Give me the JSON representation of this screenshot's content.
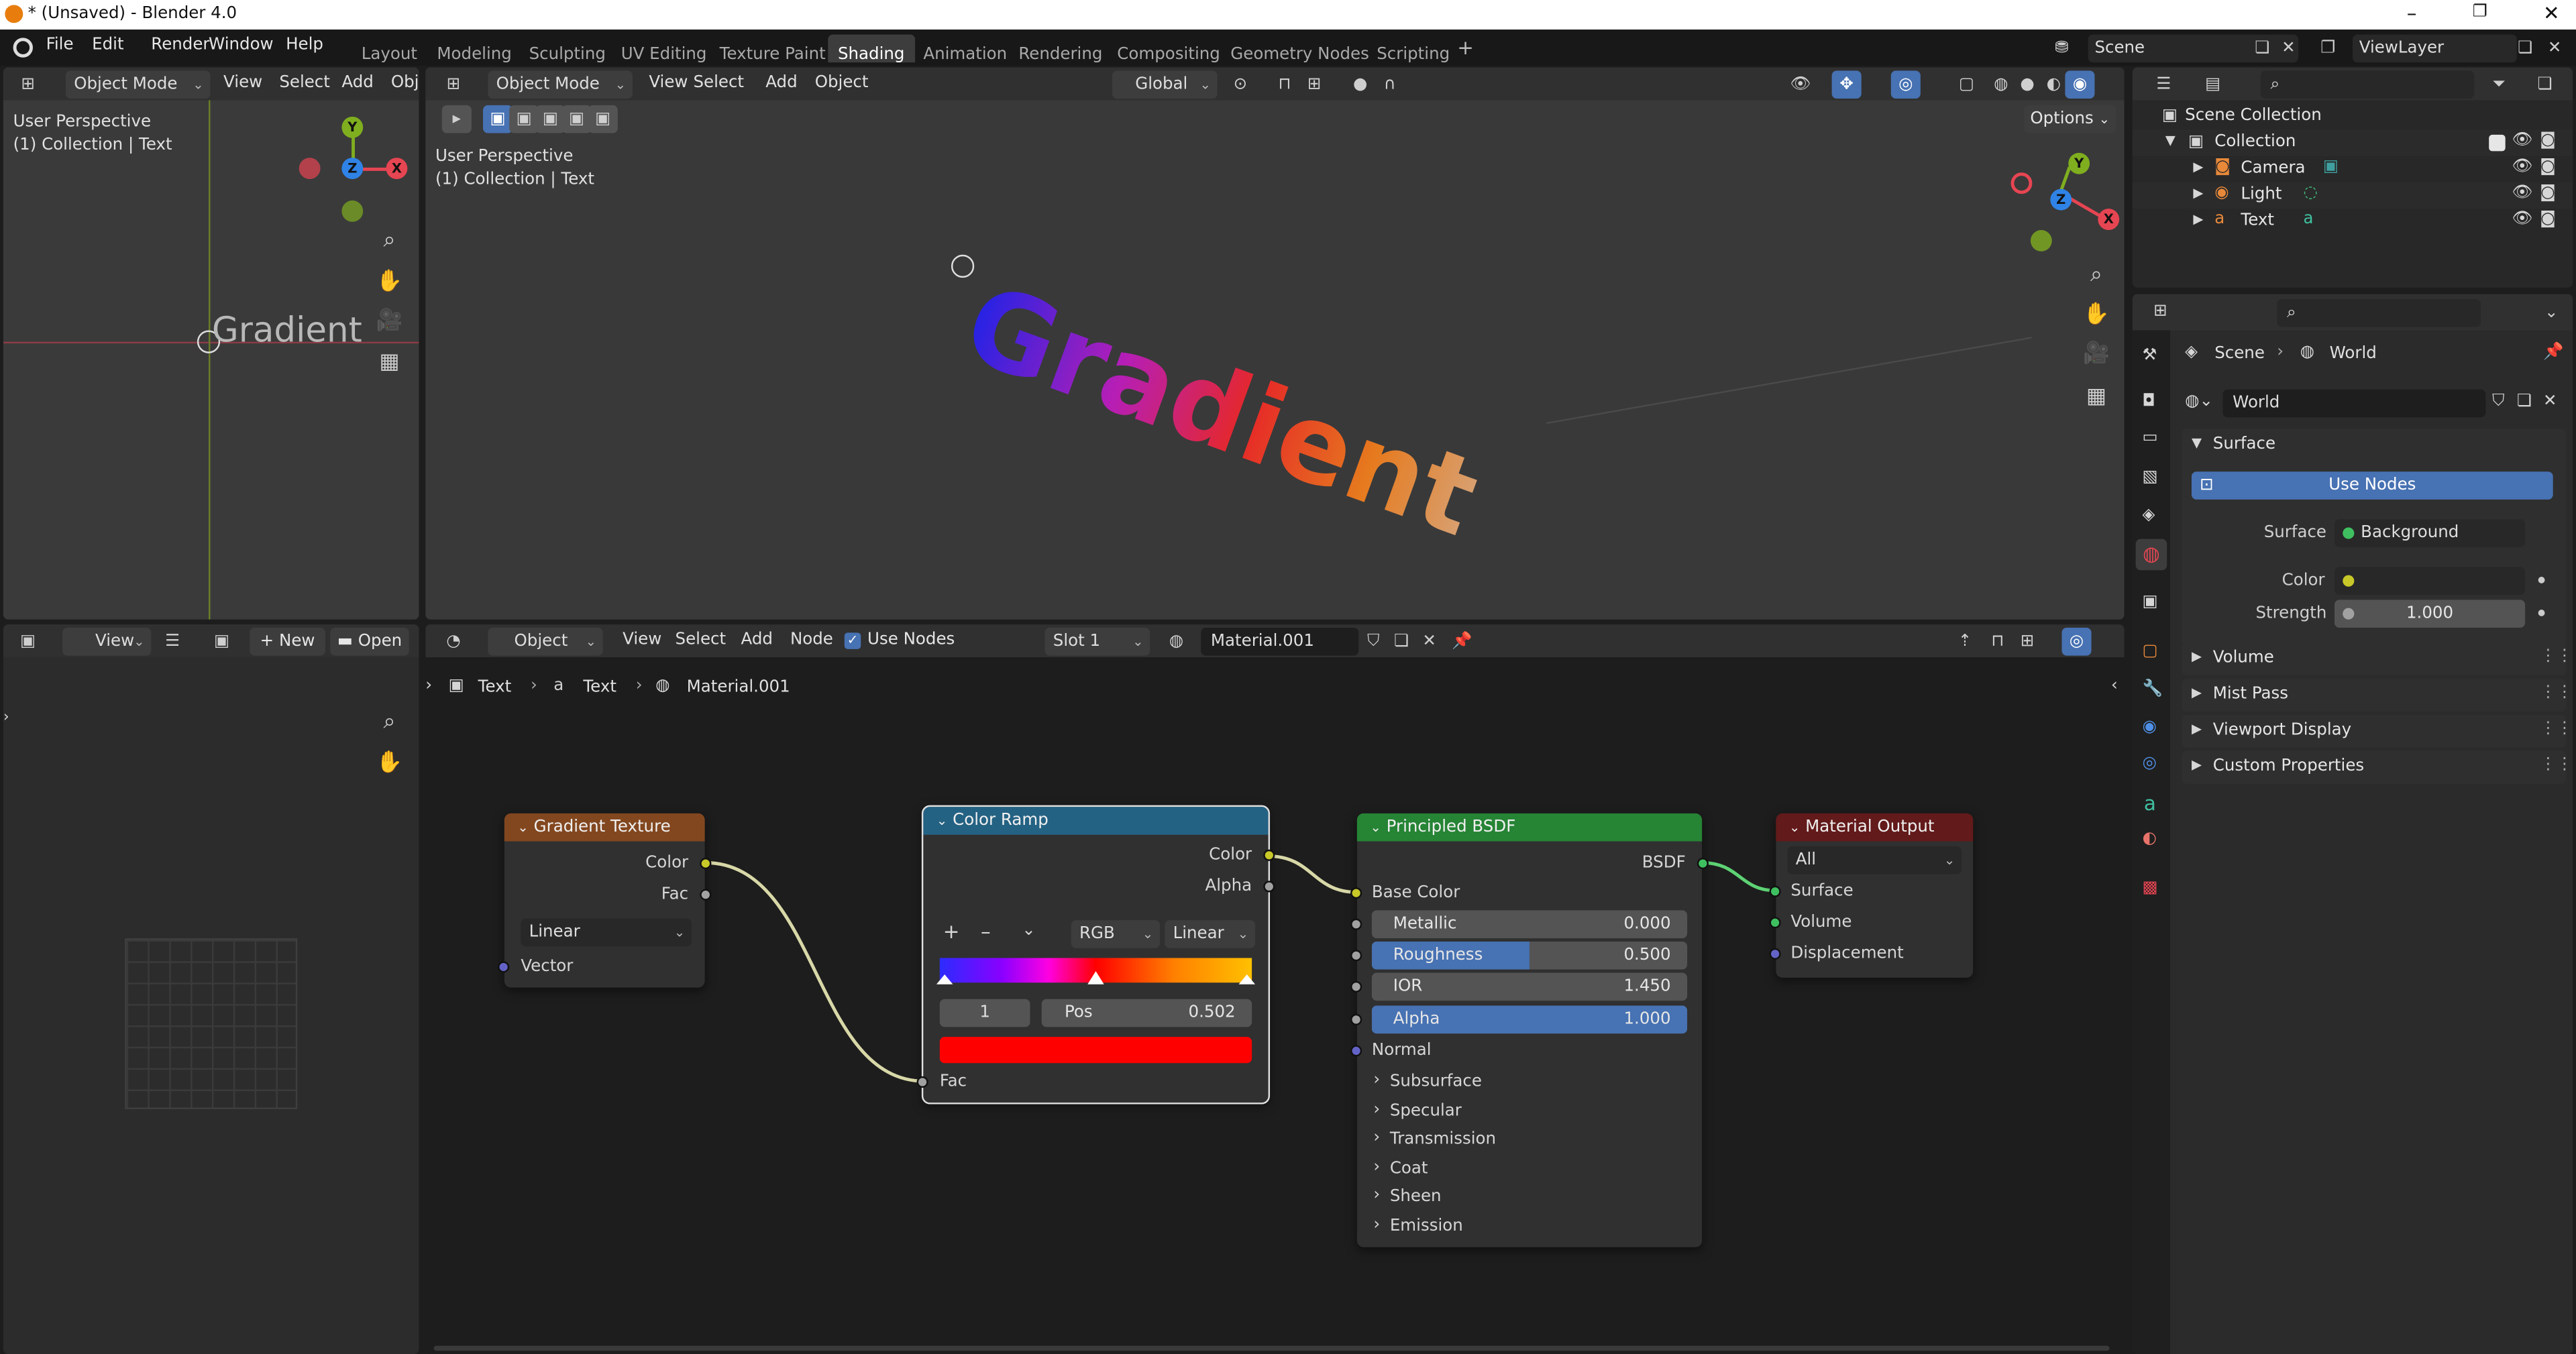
{
  "titlebar": {
    "title": "* (Unsaved) - Blender 4.0"
  },
  "menu": [
    "File",
    "Edit",
    "Render",
    "Window",
    "Help"
  ],
  "workspaces": {
    "tabs": [
      "Layout",
      "Modeling",
      "Sculpting",
      "UV Editing",
      "Texture Paint",
      "Shading",
      "Animation",
      "Rendering",
      "Compositing",
      "Geometry Nodes",
      "Scripting"
    ],
    "active": "Shading"
  },
  "scene": {
    "name": "Scene",
    "view_layer": "ViewLayer"
  },
  "left_viewport": {
    "mode": "Object Mode",
    "menus": [
      "View",
      "Select",
      "Add",
      "Obj"
    ],
    "overlay_line1": "User Perspective",
    "overlay_line2": "(1) Collection | Text",
    "text_object": "Gradient"
  },
  "main_viewport": {
    "mode": "Object Mode",
    "menus": [
      "View",
      "Select",
      "Add",
      "Object"
    ],
    "transform": "Global",
    "options": "Options",
    "overlay_line1": "User Perspective",
    "overlay_line2": "(1) Collection | Text",
    "text_object": "Gradient"
  },
  "gizmo_labels": {
    "x": "X",
    "y": "Y",
    "z": "Z"
  },
  "outliner": {
    "root": "Scene Collection",
    "collection": "Collection",
    "items": [
      "Camera",
      "Light",
      "Text"
    ]
  },
  "properties": {
    "breadcrumb_scene": "Scene",
    "breadcrumb_world": "World",
    "world_name": "World",
    "surface_section": "Surface",
    "use_nodes": "Use Nodes",
    "surface_label": "Surface",
    "surface_value": "Background",
    "color_label": "Color",
    "strength_label": "Strength",
    "strength_value": "1.000",
    "sections": [
      "Volume",
      "Mist Pass",
      "Viewport Display",
      "Custom Properties"
    ]
  },
  "image_editor": {
    "view": "View",
    "new": "New",
    "open": "Open"
  },
  "node_editor": {
    "type": "Object",
    "menus": [
      "View",
      "Select",
      "Add",
      "Node"
    ],
    "use_nodes": "Use Nodes",
    "slot": "Slot 1",
    "material": "Material.001",
    "breadcrumb": [
      "Text",
      "Text",
      "Material.001"
    ]
  },
  "nodes": {
    "gradient": {
      "title": "Gradient Texture",
      "out_color": "Color",
      "out_fac": "Fac",
      "type": "Linear",
      "in_vector": "Vector"
    },
    "ramp": {
      "title": "Color Ramp",
      "out_color": "Color",
      "out_alpha": "Alpha",
      "mode": "RGB",
      "interp": "Linear",
      "index": "1",
      "pos_label": "Pos",
      "pos_value": "0.502",
      "in_fac": "Fac"
    },
    "bsdf": {
      "title": "Principled BSDF",
      "out": "BSDF",
      "base_color": "Base Color",
      "metallic_label": "Metallic",
      "metallic_value": "0.000",
      "metallic": 0.0,
      "roughness_label": "Roughness",
      "roughness_value": "0.500",
      "roughness": 0.5,
      "ior_label": "IOR",
      "ior_value": "1.450",
      "alpha_label": "Alpha",
      "alpha_value": "1.000",
      "alpha": 1.0,
      "normal": "Normal",
      "sections": [
        "Subsurface",
        "Specular",
        "Transmission",
        "Coat",
        "Sheen",
        "Emission"
      ]
    },
    "output": {
      "title": "Material Output",
      "target": "All",
      "surface": "Surface",
      "volume": "Volume",
      "displacement": "Displacement"
    }
  },
  "colors": {
    "accent": "#4772b3",
    "gradient_header": "#83471f",
    "ramp_header": "#246283",
    "bsdf_header": "#268435",
    "output_header": "#631a1a",
    "ramp_selected": "#ff0000"
  }
}
